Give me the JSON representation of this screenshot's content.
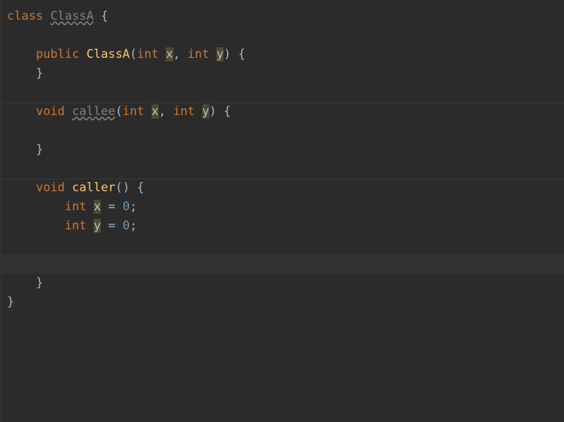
{
  "colors": {
    "background": "#2b2b2b",
    "current_line": "#323232",
    "separator": "#3a3a3a",
    "keyword": "#cc7832",
    "identifier_warn": "#808080",
    "method": "#ffc66d",
    "number": "#6897bb",
    "default_text": "#a9b7c6",
    "unused_bg": "rgba(110,100,60,0.55)"
  },
  "code": {
    "l1_kw": "class",
    "l1_name": "ClassA",
    "l1_brace": " {",
    "l3_public": "public",
    "l3_ctor": "ClassA",
    "l3_open": "(",
    "l3_int1": "int",
    "l3_x": "x",
    "l3_comma": ", ",
    "l3_int2": "int",
    "l3_y": "y",
    "l3_close": ") {",
    "l4_close": "}",
    "l6_void": "void",
    "l6_callee": "callee",
    "l6_open": "(",
    "l6_int1": "int",
    "l6_x": "x",
    "l6_comma": ", ",
    "l6_int2": "int",
    "l6_y": "y",
    "l6_close": ") {",
    "l8_close": "}",
    "l10_void": "void",
    "l10_caller": "caller",
    "l10_rest": "() {",
    "l11_int": "int",
    "l11_x": "x",
    "l11_eq": " = ",
    "l11_zero": "0",
    "l11_semi": ";",
    "l12_int": "int",
    "l12_y": "y",
    "l12_eq": " = ",
    "l12_zero": "0",
    "l12_semi": ";",
    "l15_close": "}",
    "l16_close": "}"
  }
}
